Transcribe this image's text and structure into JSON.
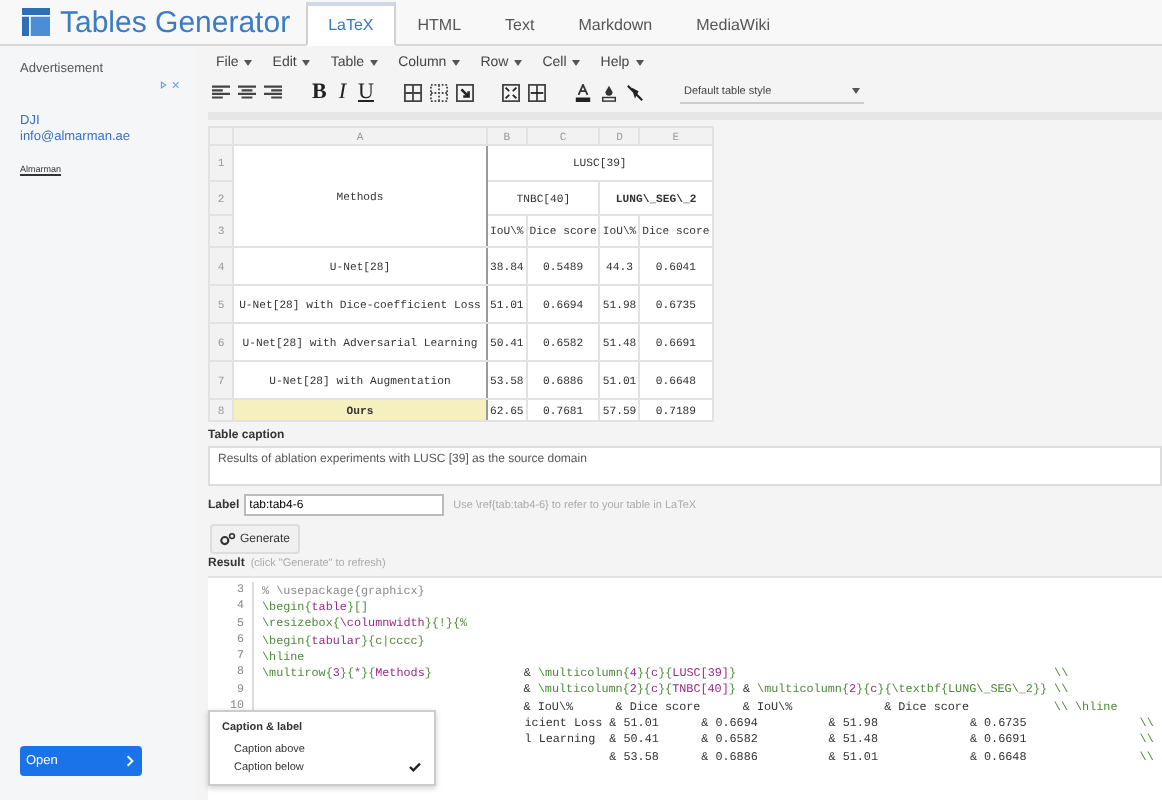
{
  "header": {
    "title": "Tables Generator",
    "tabs": [
      {
        "label": "LaTeX",
        "selected": true
      },
      {
        "label": "HTML",
        "selected": false
      },
      {
        "label": "Text",
        "selected": false
      },
      {
        "label": "Markdown",
        "selected": false
      },
      {
        "label": "MediaWiki",
        "selected": false
      }
    ]
  },
  "ad": {
    "heading": "Advertisement",
    "brand": "DJI",
    "email": "info@almarman.ae",
    "advertiser": "Almarman",
    "button": "Open"
  },
  "menu": [
    "File",
    "Edit",
    "Table",
    "Column",
    "Row",
    "Cell",
    "Help"
  ],
  "toolbar": {
    "bold": "B",
    "italic": "I",
    "underline": "U",
    "style": "Default table style"
  },
  "sheet": {
    "column_letters": [
      "A",
      "B",
      "C",
      "D",
      "E"
    ],
    "row_numbers": [
      "1",
      "2",
      "3",
      "4",
      "5",
      "6",
      "7",
      "8"
    ],
    "method_header": "Methods",
    "dataset_header": "LUSC[39]",
    "subsets": [
      {
        "text": "TNBC[40]",
        "bold": false
      },
      {
        "text": "LUNG\\_SEG\\_2",
        "bold": true
      }
    ],
    "metrics": [
      "IoU\\%",
      "Dice score",
      "IoU\\%",
      "Dice score"
    ],
    "rows": [
      {
        "method": "U-Net[28]",
        "bold": false,
        "selected": false,
        "values": [
          "38.84",
          "0.5489",
          "44.3",
          "0.6041"
        ]
      },
      {
        "method": "U-Net[28] with Dice-coefficient Loss",
        "bold": false,
        "selected": false,
        "values": [
          "51.01",
          "0.6694",
          "51.98",
          "0.6735"
        ]
      },
      {
        "method": "U-Net[28] with Adversarial Learning",
        "bold": false,
        "selected": false,
        "values": [
          "50.41",
          "0.6582",
          "51.48",
          "0.6691"
        ]
      },
      {
        "method": "U-Net[28] with Augmentation",
        "bold": false,
        "selected": false,
        "values": [
          "53.58",
          "0.6886",
          "51.01",
          "0.6648"
        ]
      },
      {
        "method": "Ours",
        "bold": true,
        "selected": true,
        "values": [
          "62.65",
          "0.7681",
          "57.59",
          "0.7189"
        ]
      }
    ]
  },
  "caption": {
    "label": "Table caption",
    "value": "Results of ablation experiments with LUSC [39] as the source domain"
  },
  "label_field": {
    "label": "Label",
    "value": "tab:tab4-6",
    "hint": "Use \\ref{tab:tab4-6} to refer to your table in LaTeX"
  },
  "generate": "Generate",
  "result": {
    "label": "Result",
    "hint": "(click \"Generate\" to refresh)",
    "lines": [
      {
        "number": "3",
        "segments": [
          {
            "kind": "comment",
            "text": "% \\usepackage{graphicx}"
          }
        ]
      },
      {
        "number": "4",
        "segments": [
          {
            "kind": "cmd",
            "text": "\\begin{"
          },
          {
            "kind": "arg",
            "text": "table"
          },
          {
            "kind": "cmd",
            "text": "}[]"
          }
        ]
      },
      {
        "number": "5",
        "segments": [
          {
            "kind": "cmd",
            "text": "\\resizebox{"
          },
          {
            "kind": "arg",
            "text": "\\columnwidth"
          },
          {
            "kind": "cmd",
            "text": "}{!}{%"
          }
        ]
      },
      {
        "number": "6",
        "segments": [
          {
            "kind": "cmd",
            "text": "\\begin{"
          },
          {
            "kind": "arg",
            "text": "tabular"
          },
          {
            "kind": "cmd",
            "text": "}{c|cccc}"
          }
        ]
      },
      {
        "number": "7",
        "segments": [
          {
            "kind": "cmd",
            "text": "\\hline"
          }
        ]
      },
      {
        "number": "8",
        "segments": [
          {
            "kind": "cmd",
            "text": "\\multirow{"
          },
          {
            "kind": "arg",
            "text": "3"
          },
          {
            "kind": "cmd",
            "text": "}{"
          },
          {
            "kind": "arg",
            "text": "*"
          },
          {
            "kind": "cmd",
            "text": "}{"
          },
          {
            "kind": "arg",
            "text": "Methods"
          },
          {
            "kind": "cmd",
            "text": "}"
          },
          {
            "kind": "plain",
            "text": "             & "
          },
          {
            "kind": "cmd",
            "text": "\\multicolumn{"
          },
          {
            "kind": "arg",
            "text": "4"
          },
          {
            "kind": "cmd",
            "text": "}{"
          },
          {
            "kind": "arg",
            "text": "c"
          },
          {
            "kind": "cmd",
            "text": "}{"
          },
          {
            "kind": "arg",
            "text": "LUSC[39]"
          },
          {
            "kind": "cmd",
            "text": "}"
          },
          {
            "kind": "cmd",
            "text": "                                             \\\\"
          }
        ]
      },
      {
        "number": "9",
        "segments": [
          {
            "kind": "plain",
            "text": "                                     & "
          },
          {
            "kind": "cmd",
            "text": "\\multicolumn{"
          },
          {
            "kind": "arg",
            "text": "2"
          },
          {
            "kind": "cmd",
            "text": "}{"
          },
          {
            "kind": "arg",
            "text": "c"
          },
          {
            "kind": "cmd",
            "text": "}{"
          },
          {
            "kind": "arg",
            "text": "TNBC[40]"
          },
          {
            "kind": "cmd",
            "text": "}"
          },
          {
            "kind": "plain",
            "text": " & "
          },
          {
            "kind": "cmd",
            "text": "\\multicolumn{"
          },
          {
            "kind": "arg",
            "text": "2"
          },
          {
            "kind": "cmd",
            "text": "}{"
          },
          {
            "kind": "arg",
            "text": "c"
          },
          {
            "kind": "cmd",
            "text": "}{\\textbf{LUNG\\_SEG\\_2}} \\\\"
          }
        ]
      },
      {
        "number": "10",
        "segments": [
          {
            "kind": "plain",
            "text": "                                     & IoU\\%      & Dice score      & IoU\\%             & Dice score            "
          },
          {
            "kind": "cmd",
            "text": "\\\\ \\hline"
          }
        ]
      },
      {
        "segments": [
          {
            "kind": "plain",
            "text": "icient Loss & 51.01      & 0.6694          & 51.98             & 0.6735                "
          },
          {
            "kind": "cmd",
            "text": "\\\\"
          }
        ]
      },
      {
        "segments": [
          {
            "kind": "plain",
            "text": "l Learning  & 50.41      & 0.6582          & 51.48             & 0.6691                "
          },
          {
            "kind": "cmd",
            "text": "\\\\"
          }
        ]
      },
      {
        "segments": [
          {
            "kind": "plain",
            "text": "            & 53.58      & 0.6886          & 51.01             & 0.6648                "
          },
          {
            "kind": "cmd",
            "text": "\\\\"
          }
        ]
      }
    ]
  },
  "popup": {
    "heading": "Caption & label",
    "items": [
      {
        "label": "Caption above",
        "checked": false
      },
      {
        "label": "Caption below",
        "checked": true
      }
    ]
  }
}
